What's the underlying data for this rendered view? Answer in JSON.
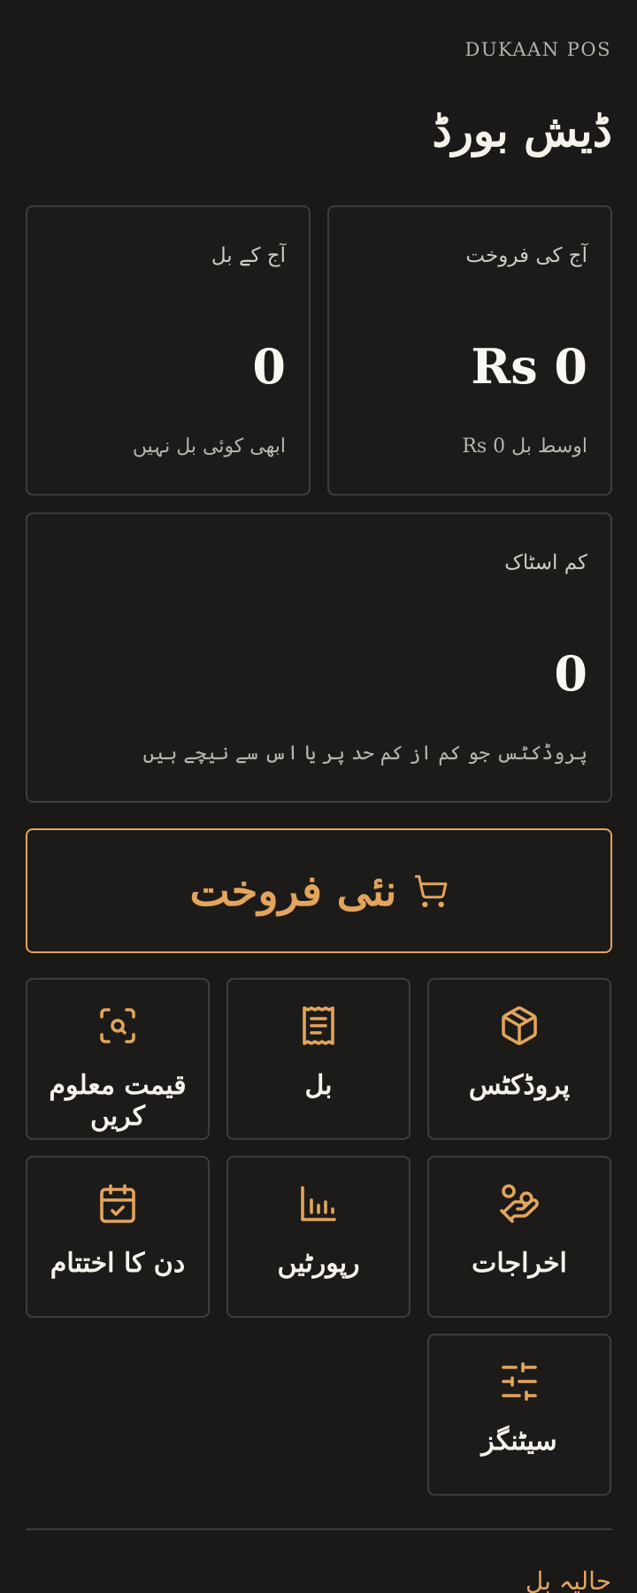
{
  "header": {
    "brand": "DUKAAN POS",
    "title": "ڈیش بورڈ"
  },
  "cards": {
    "sales": {
      "label": "آج کی فروخت",
      "value": "Rs 0",
      "sub": "اوسط بل Rs 0"
    },
    "bills": {
      "label": "آج کے بل",
      "value": "0",
      "sub": "ابھی کوئی بل نہیں"
    },
    "stock": {
      "label": "کم اسٹاک",
      "value": "0",
      "sub": "پروڈکٹس جو کم از کم حد پر یا اس سے نیچے ہیں"
    }
  },
  "new_sale": {
    "label": "نئی فروخت",
    "icon": "cart-icon"
  },
  "tiles": {
    "products": {
      "label": "پروڈکٹس",
      "icon": "box-icon"
    },
    "bills": {
      "label": "بل",
      "icon": "receipt-icon"
    },
    "price": {
      "label": "قیمت معلوم کریں",
      "icon": "scan-search-icon"
    },
    "expenses": {
      "label": "اخراجات",
      "icon": "hand-coins-icon"
    },
    "reports": {
      "label": "رپورٹیں",
      "icon": "bar-chart-icon"
    },
    "dayend": {
      "label": "دن کا اختتام",
      "icon": "calendar-check-icon"
    },
    "settings": {
      "label": "سیٹنگز",
      "icon": "sliders-icon"
    }
  },
  "recent": {
    "title": "حالیہ بل"
  },
  "colors": {
    "background": "#1a1918",
    "accent": "#e3a45c",
    "border": "#3f3d3a",
    "text": "#f6f2ea"
  }
}
